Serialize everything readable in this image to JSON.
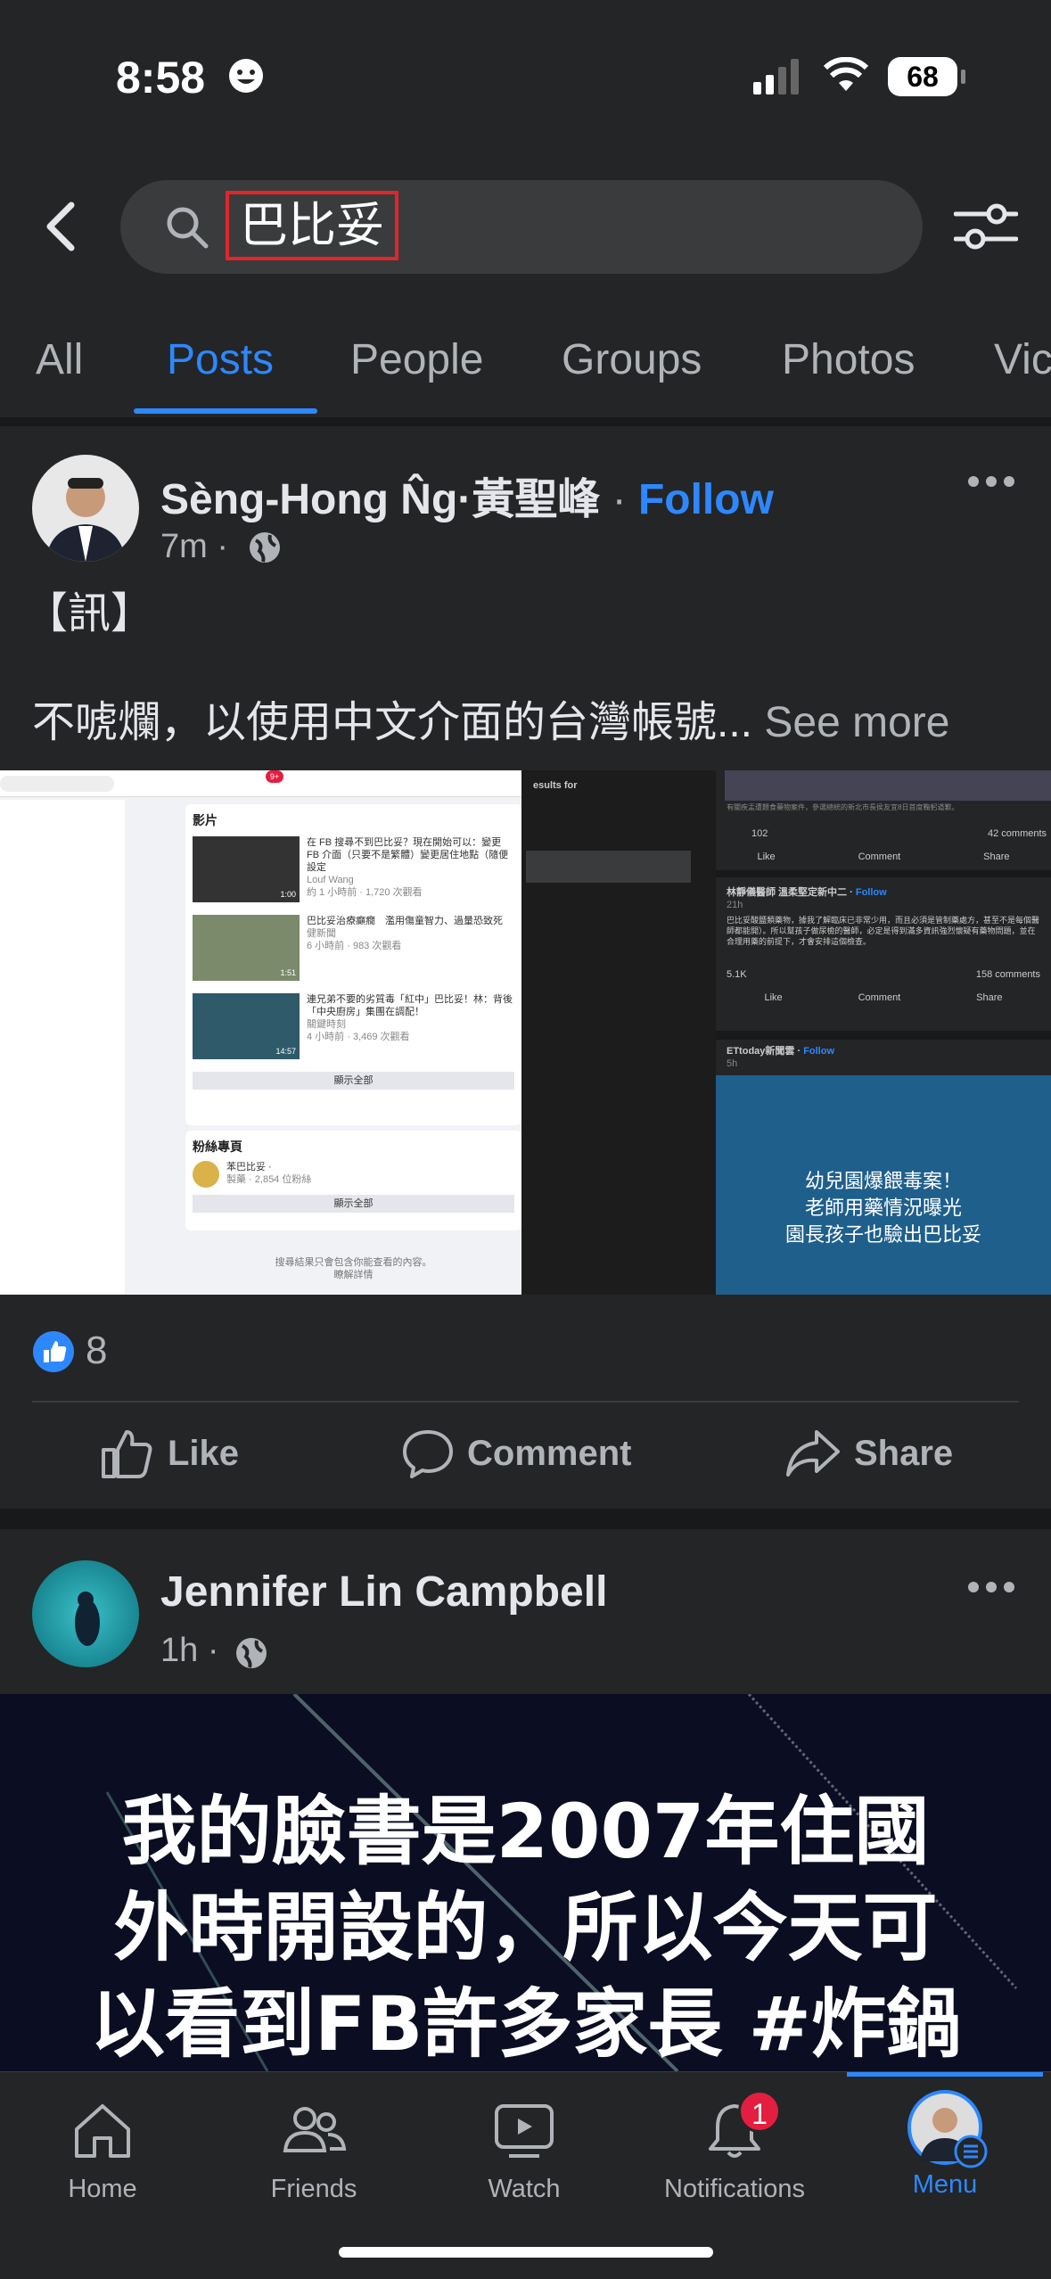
{
  "status_bar": {
    "time": "8:58",
    "battery": "68"
  },
  "search": {
    "query": "巴比妥"
  },
  "tabs": [
    {
      "label": "All"
    },
    {
      "label": "Posts"
    },
    {
      "label": "People"
    },
    {
      "label": "Groups"
    },
    {
      "label": "Photos"
    },
    {
      "label": "Vic"
    }
  ],
  "active_tab": "Posts",
  "posts": [
    {
      "author": "Sèng-Hong N̂g·黃聖峰",
      "follow": "Follow",
      "time": "7m",
      "title": "【訊】",
      "text": "不唬爛，以使用中文介面的台灣帳號...",
      "see_more": "See more",
      "reaction_count": "8",
      "actions": {
        "like": "Like",
        "comment": "Comment",
        "share": "Share"
      },
      "screenshot": {
        "left": {
          "videos_heading": "影片",
          "videos": [
            {
              "title": "在 FB 搜尋不到巴比妥？現在開始可以：變更 FB 介面（只要不是繁體）變更居住地點（隨便設定",
              "source": "Louf Wang",
              "meta": "約 1 小時前 · 1,720 次觀看",
              "duration": "1:00"
            },
            {
              "title": "巴比妥治療癲癇　濫用傷童智力、過量恐致死",
              "source": "健新聞",
              "meta": "6 小時前 · 983 次觀看",
              "duration": "1:51"
            },
            {
              "title": "連兄弟不要的劣質毒「紅中」巴比妥！林：背後「中央廚房」集團在調配！",
              "source": "關鍵時刻",
              "meta": "4 小時前 · 3,469 次觀看",
              "duration": "14:57"
            }
          ],
          "see_all": "顯示全部",
          "pages_heading": "粉絲專頁",
          "page": {
            "name": "苯巴比妥 ·",
            "meta": "製藥 · 2,854 位粉絲"
          },
          "footer": "搜尋結果只會包含你能查看的內容。",
          "learn_more": "瞭解詳情",
          "badge": "9+",
          "results_for": "esults for"
        },
        "right": {
          "caption": "有關疾盂遭餵食藥物案件，參選總統的新北市長侯友宜8日首度鞠躬道歉。",
          "post1": {
            "reactions": "102",
            "comments": "42 comments",
            "like": "Like",
            "comment": "Comment",
            "share": "Share"
          },
          "post2": {
            "author": "林靜儀醫師 溫柔堅定新中二",
            "follow": "Follow",
            "time": "21h",
            "text": "巴比妥酸鹽類藥物，據我了解臨床已非常少用，而且必須是管制藥處方，甚至不是每個醫師都能開）。所以幫孩子做尿檢的醫師，必定是得到滿多資訊強烈懷疑有藥物問題，並在合理用藥的前提下，才會安排這個檢查。",
            "reactions": "5.1K",
            "comments": "158 comments"
          },
          "post3": {
            "author": "ETtoday新聞雲",
            "follow": "Follow",
            "time": "5h",
            "headline": [
              "幼兒園爆餵毒案！",
              "老師用藥情況曝光",
              "園長孩子也驗出巴比妥"
            ]
          }
        }
      }
    },
    {
      "author": "Jennifer Lin Campbell",
      "time": "1h",
      "image_text": [
        "我的臉書是2007年住國",
        "外時開設的，所以今天可",
        "以看到FB許多家長 #炸鍋"
      ]
    }
  ],
  "nav": [
    {
      "label": "Home",
      "icon": "home-icon"
    },
    {
      "label": "Friends",
      "icon": "friends-icon"
    },
    {
      "label": "Watch",
      "icon": "watch-icon"
    },
    {
      "label": "Notifications",
      "icon": "bell-icon",
      "badge": "1"
    },
    {
      "label": "Menu",
      "icon": "avatar-menu-icon"
    }
  ],
  "colors": {
    "accent": "#2d88ff",
    "background": "#242526",
    "badge": "#e41e3f"
  }
}
